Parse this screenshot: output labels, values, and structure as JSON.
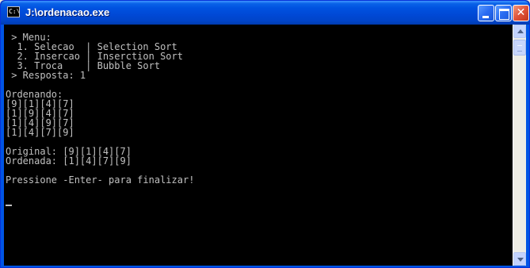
{
  "window": {
    "title": "J:\\ordenacao.exe",
    "icon_text": "C:\\"
  },
  "controls": {
    "minimize_icon": "minimize-icon",
    "maximize_icon": "maximize-icon",
    "close_label": "✕"
  },
  "console": {
    "text": " > Menu:\n  1. Selecao  | Selection Sort\n  2. Insercao | Inserction Sort\n  3. Troca    | Bubble Sort\n > Resposta: 1\n\nOrdenando:\n[9][1][4][7]\n[1][9][4][7]\n[1][4][9][7]\n[1][4][7][9]\n\nOriginal: [9][1][4][7]\nOrdenada: [1][4][7][9]\n\nPressione -Enter- para finalizar!"
  },
  "colors": {
    "console_bg": "#000000",
    "console_fg": "#c0c0c0",
    "titlebar": "#0054e3"
  }
}
